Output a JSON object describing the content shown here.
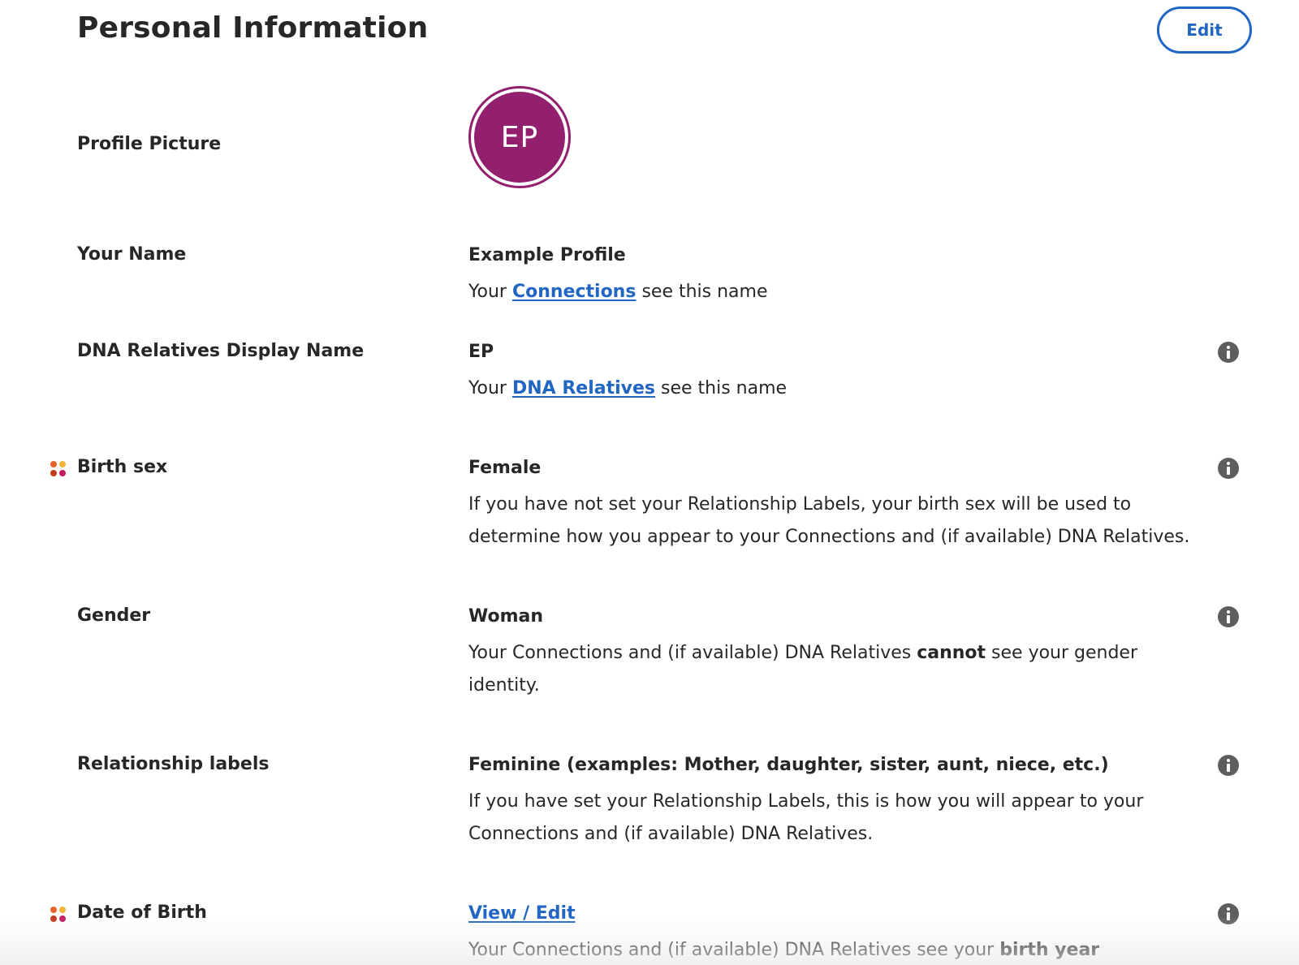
{
  "header": {
    "title": "Personal Information",
    "edit_label": "Edit"
  },
  "colors": {
    "accent": "#2266c4",
    "avatar": "#93206f",
    "info_icon": "#5e5e5e",
    "dots": [
      "#e8632a",
      "#f2b53a",
      "#c43a1d",
      "#c41c62"
    ]
  },
  "rows": {
    "profile_picture": {
      "label": "Profile Picture",
      "avatar_initials": "EP"
    },
    "your_name": {
      "label": "Your Name",
      "value": "Example Profile",
      "desc_prefix": "Your ",
      "desc_link": "Connections",
      "desc_suffix": " see this name"
    },
    "dna_display_name": {
      "label": "DNA Relatives Display Name",
      "value": "EP",
      "desc_prefix": "Your ",
      "desc_link": "DNA Relatives",
      "desc_suffix": " see this name",
      "icon": "info-icon"
    },
    "birth_sex": {
      "label": "Birth sex",
      "marker_icon": "genetic-data-dots-icon",
      "value": "Female",
      "desc": "If you have not set your Relationship Labels, your birth sex will be used to determine how you appear to your Connections and (if available) DNA Relatives.",
      "icon": "info-icon"
    },
    "gender": {
      "label": "Gender",
      "value": "Woman",
      "desc_prefix": "Your Connections and (if available) DNA Relatives ",
      "desc_bold": "cannot",
      "desc_suffix": " see your gender identity.",
      "icon": "info-icon"
    },
    "relationship_labels": {
      "label": "Relationship labels",
      "value": "Feminine (examples: Mother, daughter, sister, aunt, niece, etc.)",
      "desc": "If you have set your Relationship Labels, this is how you will appear to your Connections and (if available) DNA Relatives.",
      "icon": "info-icon"
    },
    "date_of_birth": {
      "label": "Date of Birth",
      "marker_icon": "genetic-data-dots-icon",
      "value_link": "View / Edit",
      "desc_prefix": "Your Connections and (if available) DNA Relatives see your ",
      "desc_bold": "birth year",
      "icon": "info-icon"
    }
  }
}
